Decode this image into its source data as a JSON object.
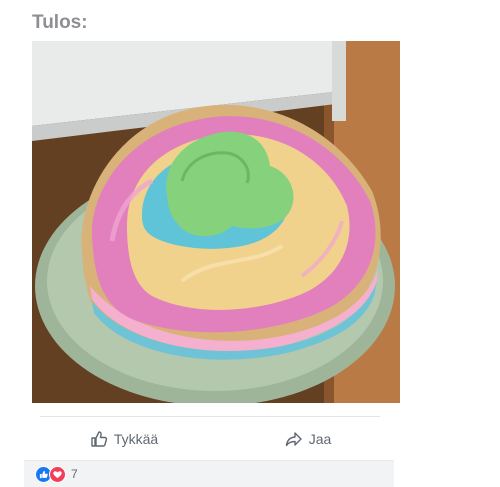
{
  "post": {
    "caption": "Tulos:",
    "image_alt": "Sateenkaarikakku lautasella",
    "actions": {
      "like_label": "Tykkää",
      "share_label": "Jaa"
    },
    "reactions": {
      "types": [
        "like-icon",
        "love-icon"
      ],
      "count": "7"
    }
  },
  "colors": {
    "caption": "#8d8f94",
    "action_text": "#606770",
    "like_blue": "#1877f2",
    "love_red": "#f33e58",
    "reaction_bar": "#f2f3f5"
  }
}
